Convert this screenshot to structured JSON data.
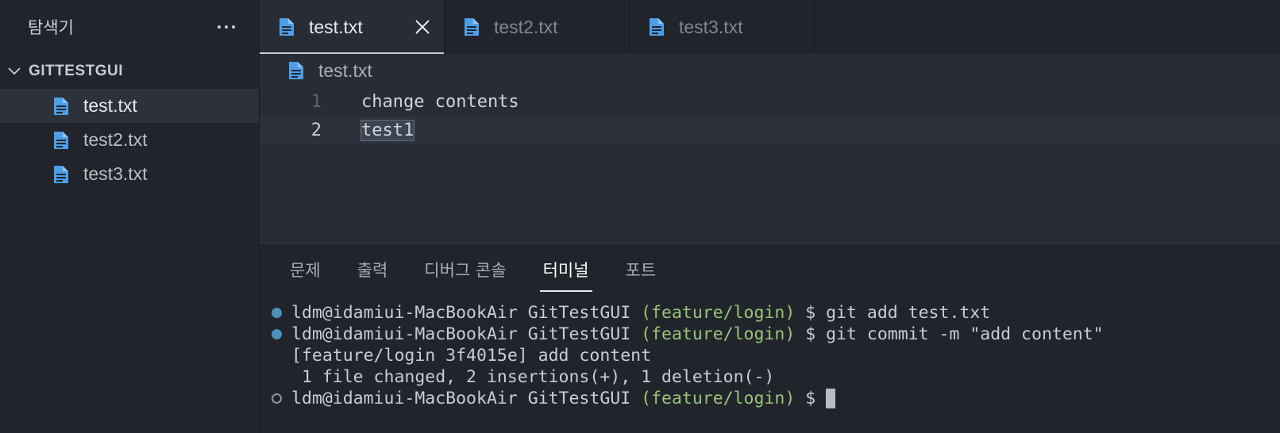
{
  "sidebar": {
    "title": "탐색기",
    "folder": "GITTESTGUI",
    "files": [
      {
        "name": "test.txt",
        "active": true
      },
      {
        "name": "test2.txt",
        "active": false
      },
      {
        "name": "test3.txt",
        "active": false
      }
    ]
  },
  "tabs": [
    {
      "label": "test.txt",
      "active": true
    },
    {
      "label": "test2.txt",
      "active": false
    },
    {
      "label": "test3.txt",
      "active": false
    }
  ],
  "editor": {
    "breadcrumb": "test.txt",
    "lines": [
      {
        "number": "1",
        "text": "change contents"
      },
      {
        "number": "2",
        "text": "test1"
      }
    ]
  },
  "panel": {
    "tabs": [
      "문제",
      "출력",
      "디버그 콘솔",
      "터미널",
      "포트"
    ],
    "active_tab": "터미널"
  },
  "terminal": {
    "prompt": "ldm@idamiui-MacBookAir GitTestGUI ",
    "branch": "(feature/login)",
    "lines": [
      {
        "cmd": " $ git add test.txt"
      },
      {
        "cmd": " $ git commit -m \"add content\""
      },
      {
        "output": "[feature/login 3f4015e] add content"
      },
      {
        "output": " 1 file changed, 2 insertions(+), 1 deletion(-)"
      },
      {
        "cmd": " $ "
      }
    ]
  },
  "colors": {
    "file_icon": "#4d9ee8",
    "branch": "#98c379",
    "terminal_dot": "#4b8fba"
  }
}
